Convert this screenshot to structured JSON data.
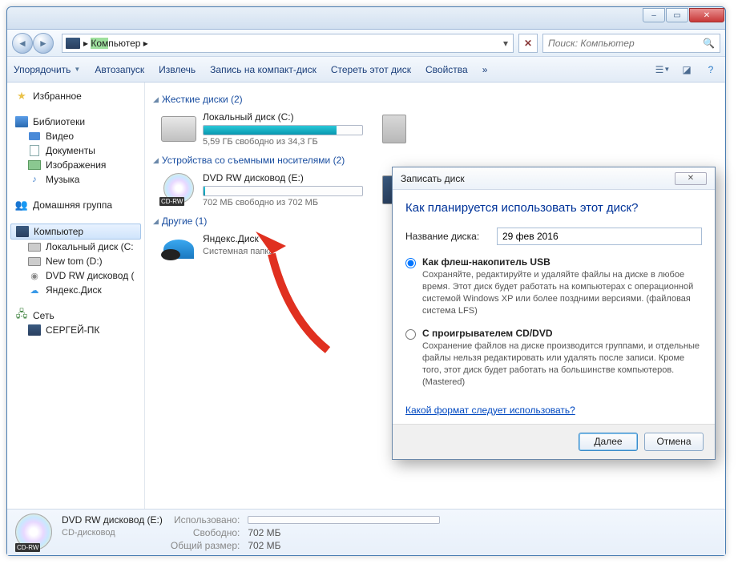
{
  "titlebar": {
    "min": "–",
    "max": "▭",
    "close": "✕"
  },
  "nav": {
    "address_prefix": "▸ ",
    "address_hl": "Ком",
    "address_rest": "пьютер ▸",
    "refresh_x": "✕",
    "search_placeholder": "Поиск: Компьютер",
    "search_icon": "🔍"
  },
  "toolbar": {
    "organize": "Упорядочить",
    "autorun": "Автозапуск",
    "eject": "Извлечь",
    "burn": "Запись на компакт-диск",
    "erase": "Стереть этот диск",
    "properties": "Свойства",
    "help": "?"
  },
  "sidebar": {
    "favorites": "Избранное",
    "libraries": "Библиотеки",
    "videos": "Видео",
    "documents": "Документы",
    "pictures": "Изображения",
    "music": "Музыка",
    "homegroup": "Домашняя группа",
    "computer": "Компьютер",
    "localdisk": "Локальный диск (C:",
    "newtom": "New tom (D:)",
    "dvdrw": "DVD RW дисковод (",
    "yandex": "Яндекс.Диск",
    "network": "Сеть",
    "pc": "СЕРГЕЙ-ПК"
  },
  "content": {
    "hdd_header": "Жесткие диски (2)",
    "c_name": "Локальный диск (C:)",
    "c_stat": "5,59 ГБ свободно из 34,3 ГБ",
    "c_fill_pct": 84,
    "removable_header": "Устройства со съемными носителями (2)",
    "e_name": "DVD RW дисковод (E:)",
    "e_stat": "702 МБ свободно из 702 МБ",
    "e_fill_pct": 1,
    "other_header": "Другие (1)",
    "yd_name": "Яндекс.Диск",
    "yd_sub": "Системная папка"
  },
  "status": {
    "name": "DVD RW дисковод (E:)",
    "sub": "CD-дисковод",
    "used_lbl": "Использовано:",
    "free_lbl": "Свободно:",
    "free_val": "702 МБ",
    "total_lbl": "Общий размер:",
    "total_val": "702 МБ"
  },
  "dialog": {
    "title": "Записать диск",
    "question": "Как планируется использовать этот диск?",
    "name_label": "Название диска:",
    "name_value": "29 фев 2016",
    "opt1_title": "Как флеш-накопитель USB",
    "opt1_desc": "Сохраняйте, редактируйте и удаляйте файлы на диске в любое время. Этот диск будет работать на компьютерах с операционной системой Windows XP или более поздними версиями. (файловая система LFS)",
    "opt2_title": "С проигрывателем CD/DVD",
    "opt2_desc": "Сохранение файлов на диске производится группами, и отдельные файлы нельзя редактировать или удалять после записи. Кроме того, этот диск будет работать на большинстве компьютеров. (Mastered)",
    "link": "Какой формат следует использовать?",
    "next": "Далее",
    "cancel": "Отмена"
  }
}
